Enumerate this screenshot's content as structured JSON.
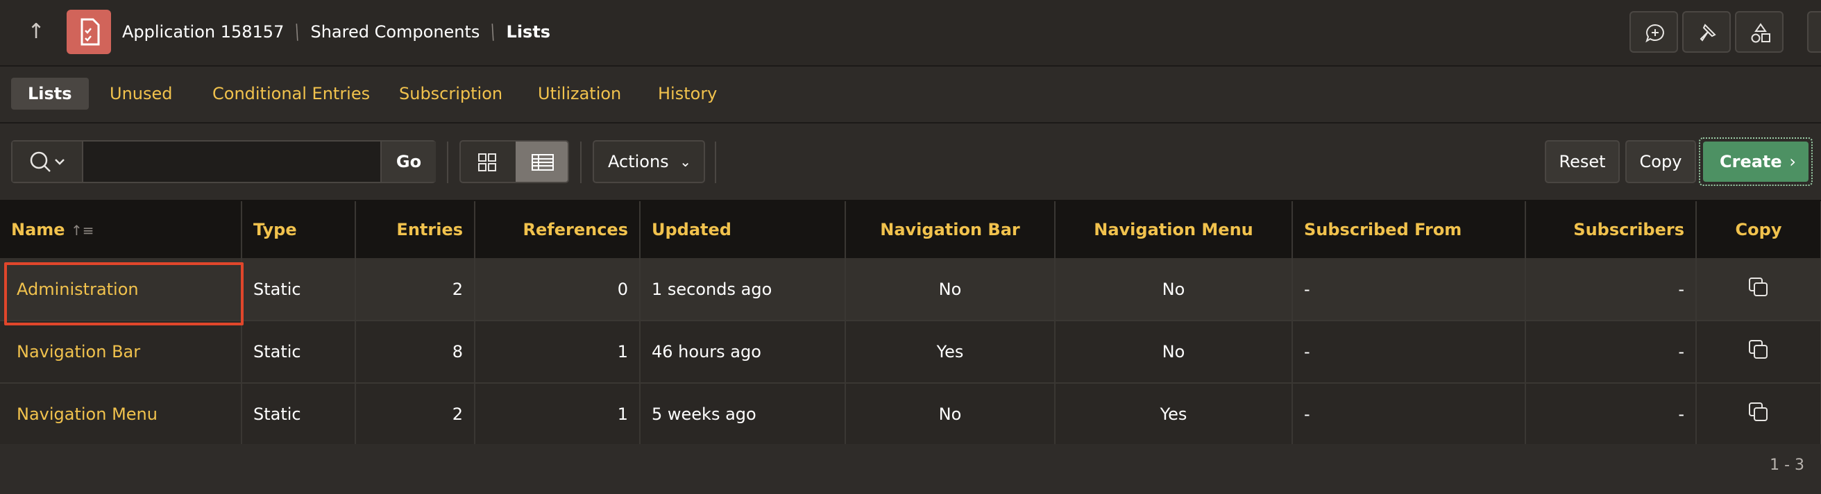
{
  "header": {
    "breadcrumb": [
      {
        "label": "Application 158157"
      },
      {
        "label": "Shared Components"
      },
      {
        "label": "Lists"
      }
    ]
  },
  "tabs": [
    {
      "label": "Lists",
      "active": true
    },
    {
      "label": "Unused"
    },
    {
      "label": "Conditional Entries"
    },
    {
      "label": "Subscription"
    },
    {
      "label": "Utilization"
    },
    {
      "label": "History"
    }
  ],
  "toolbar": {
    "search_value": "",
    "go_label": "Go",
    "actions_label": "Actions",
    "reset_label": "Reset",
    "copy_label": "Copy",
    "create_label": "Create"
  },
  "table": {
    "columns": [
      "Name",
      "Type",
      "Entries",
      "References",
      "Updated",
      "Navigation Bar",
      "Navigation Menu",
      "Subscribed From",
      "Subscribers",
      "Copy"
    ],
    "rows": [
      {
        "name": "Administration",
        "type": "Static",
        "entries": "2",
        "references": "0",
        "updated": "1 seconds ago",
        "nav_bar": "No",
        "nav_menu": "No",
        "subscribed_from": "-",
        "subscribers": "-"
      },
      {
        "name": "Navigation Bar",
        "type": "Static",
        "entries": "8",
        "references": "1",
        "updated": "46 hours ago",
        "nav_bar": "Yes",
        "nav_menu": "No",
        "subscribed_from": "-",
        "subscribers": "-"
      },
      {
        "name": "Navigation Menu",
        "type": "Static",
        "entries": "2",
        "references": "1",
        "updated": "5 weeks ago",
        "nav_bar": "No",
        "nav_menu": "Yes",
        "subscribed_from": "-",
        "subscribers": "-"
      }
    ]
  },
  "pagination": {
    "range": "1 - 3"
  },
  "colors": {
    "accent": "#f1c24d",
    "create": "#4d9163",
    "app_badge": "#d1645a",
    "highlight": "#e0462b"
  }
}
